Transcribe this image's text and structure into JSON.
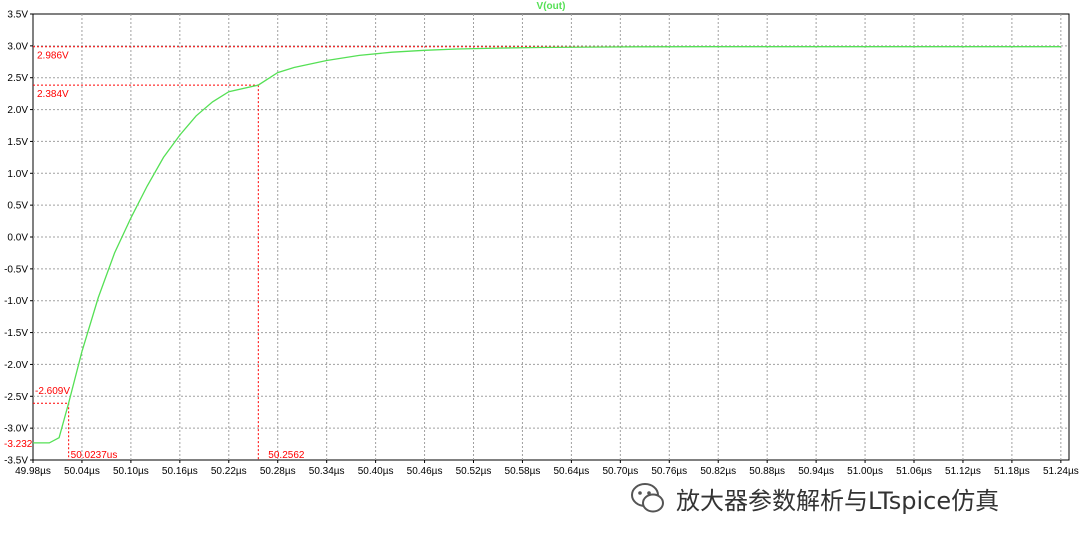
{
  "chart_data": {
    "type": "line",
    "title": "V(out)",
    "xlabel": "",
    "ylabel": "",
    "xlim": [
      49.98,
      51.25
    ],
    "ylim": [
      -3.5,
      3.5
    ],
    "grid": true,
    "x_unit": "μs",
    "y_unit": "V",
    "x_ticks": [
      "49.98µs",
      "50.04µs",
      "50.10µs",
      "50.16µs",
      "50.22µs",
      "50.28µs",
      "50.34µs",
      "50.40µs",
      "50.46µs",
      "50.52µs",
      "50.58µs",
      "50.64µs",
      "50.70µs",
      "50.76µs",
      "50.82µs",
      "50.88µs",
      "50.94µs",
      "51.00µs",
      "51.06µs",
      "51.12µs",
      "51.18µs",
      "51.24µs"
    ],
    "x_tick_values": [
      49.98,
      50.04,
      50.1,
      50.16,
      50.22,
      50.28,
      50.34,
      50.4,
      50.46,
      50.52,
      50.58,
      50.64,
      50.7,
      50.76,
      50.82,
      50.88,
      50.94,
      51.0,
      51.06,
      51.12,
      51.18,
      51.24
    ],
    "y_ticks": [
      "3.5V",
      "3.0V",
      "2.5V",
      "2.0V",
      "1.5V",
      "1.0V",
      "0.5V",
      "0.0V",
      "-0.5V",
      "-1.0V",
      "-1.5V",
      "-2.0V",
      "-2.5V",
      "-3.0V",
      "-3.5V"
    ],
    "y_tick_values": [
      3.5,
      3.0,
      2.5,
      2.0,
      1.5,
      1.0,
      0.5,
      0.0,
      -0.5,
      -1.0,
      -1.5,
      -2.0,
      -2.5,
      -3.0,
      -3.5
    ],
    "series": [
      {
        "name": "V(out)",
        "color": "#55e055",
        "x": [
          49.98,
          50.0,
          50.012,
          50.0237,
          50.04,
          50.06,
          50.08,
          50.1,
          50.12,
          50.14,
          50.16,
          50.18,
          50.2,
          50.22,
          50.2562,
          50.28,
          50.3,
          50.34,
          50.38,
          50.42,
          50.46,
          50.5,
          50.55,
          50.6,
          50.66,
          50.72,
          50.8,
          51.0,
          51.24
        ],
        "y": [
          -3.232,
          -3.232,
          -3.15,
          -2.609,
          -1.8,
          -0.95,
          -0.25,
          0.3,
          0.8,
          1.25,
          1.6,
          1.9,
          2.12,
          2.28,
          2.384,
          2.58,
          2.66,
          2.77,
          2.85,
          2.9,
          2.93,
          2.95,
          2.965,
          2.975,
          2.98,
          2.985,
          2.986,
          2.986,
          2.986
        ]
      }
    ],
    "cursors": {
      "color": "#ff0000",
      "levels": [
        {
          "label": "2.986V",
          "y": 2.986
        },
        {
          "label": "2.384V",
          "y": 2.384
        },
        {
          "label": "-2.609V",
          "y": -2.609
        },
        {
          "label": "-3.232",
          "y": -3.232
        }
      ],
      "times": [
        {
          "label": "50.0237us",
          "x": 50.0237
        },
        {
          "label": "50.2562",
          "x": 50.2562
        }
      ]
    }
  },
  "colors": {
    "trace": "#55e055",
    "cursor": "#ff0000",
    "grid": "#a0a0a0",
    "frame": "#000000"
  },
  "watermark": {
    "text": "放大器参数解析与LTspice仿真",
    "icon": "wechat-logo"
  }
}
